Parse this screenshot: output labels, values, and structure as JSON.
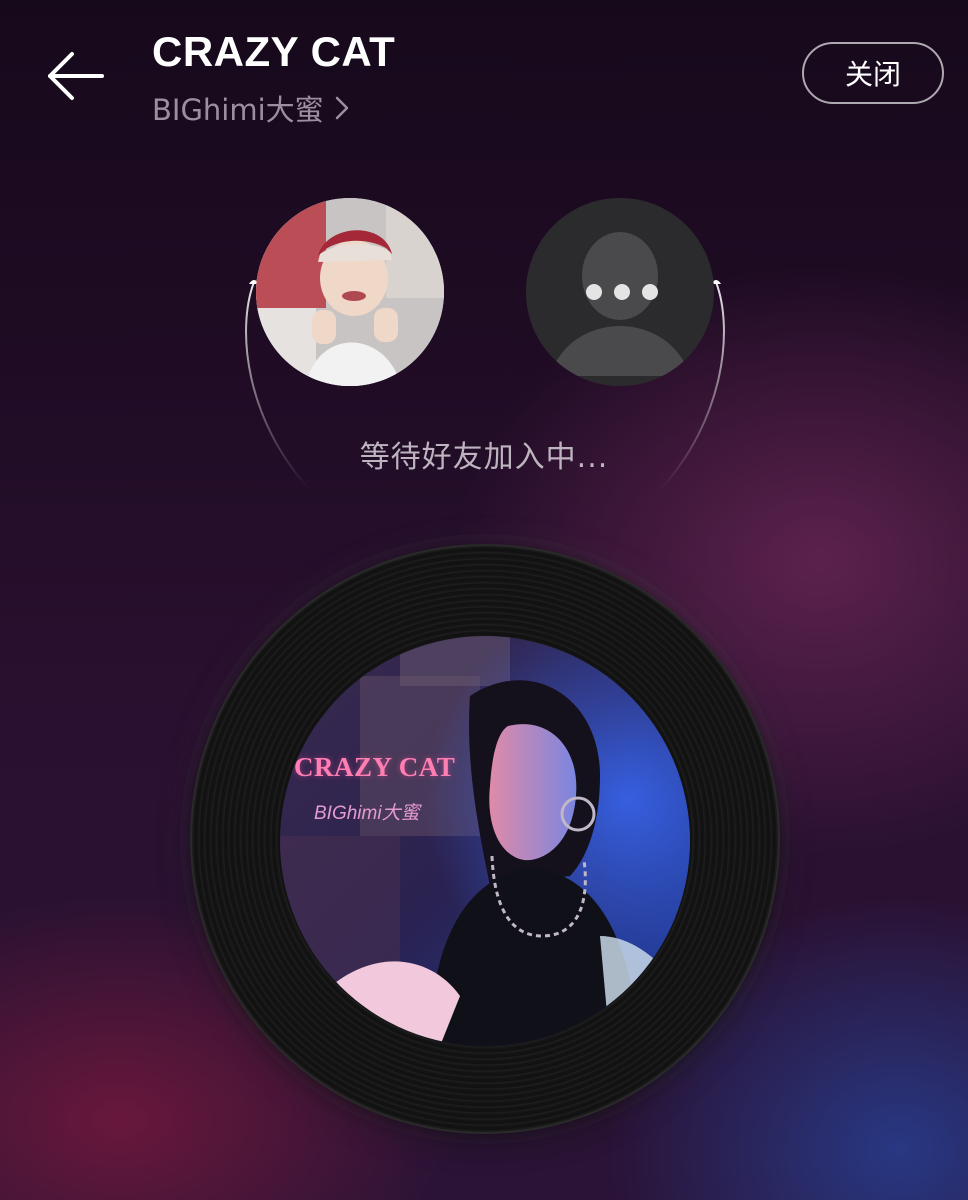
{
  "header": {
    "back_icon": "arrow-left-icon",
    "song_title": "CRAZY CAT",
    "artist": "BIGhimi大蜜",
    "artist_chevron_icon": "chevron-right-icon",
    "close_label": "关闭"
  },
  "session": {
    "user_avatar": "user-avatar-photo",
    "friend_avatar_icon": "placeholder-person-icon",
    "friend_loading_icon": "loading-dots-icon",
    "status_text": "等待好友加入中..."
  },
  "album": {
    "cover_title": "CRAZY CAT",
    "cover_artist": "BIGhimi大蜜"
  },
  "colors": {
    "background_top": "#17091c",
    "accent_pink": "#ff7fb3",
    "text_secondary": "#9c8f9f"
  }
}
